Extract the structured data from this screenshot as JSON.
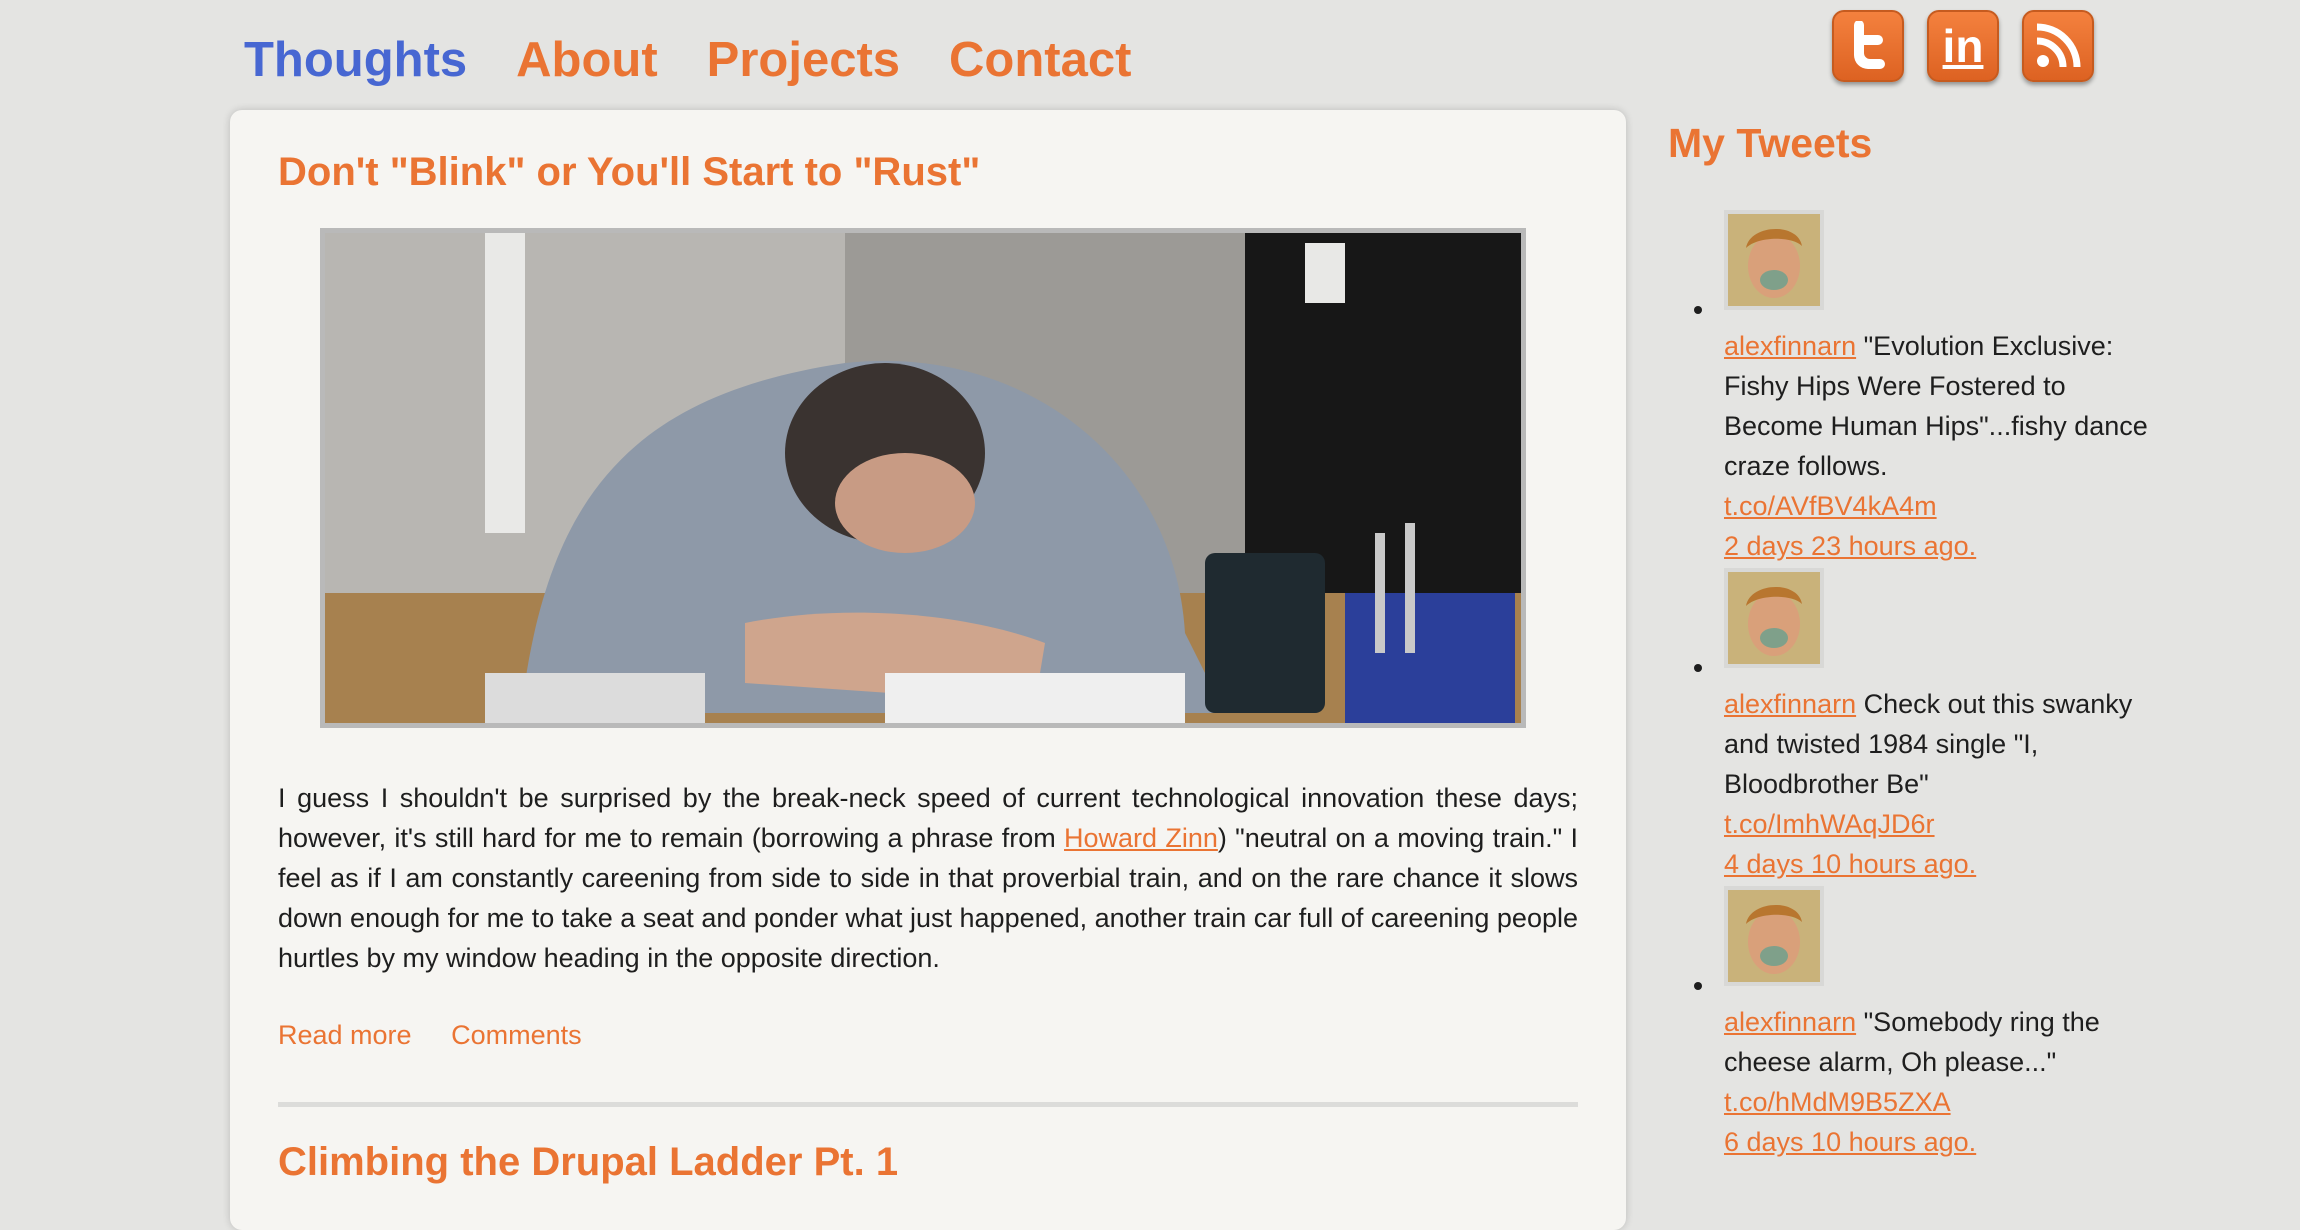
{
  "nav": {
    "items": [
      {
        "label": "Thoughts",
        "active": true
      },
      {
        "label": "About",
        "active": false
      },
      {
        "label": "Projects",
        "active": false
      },
      {
        "label": "Contact",
        "active": false
      }
    ]
  },
  "social": {
    "icons": [
      "twitter-icon",
      "linkedin-icon",
      "rss-icon"
    ],
    "linkedin_label": "in"
  },
  "post": {
    "title": "Don't \"Blink\" or You'll Start to \"Rust\"",
    "image_alt": "",
    "body_before_link": "I guess I shouldn't be surprised by the break-neck speed of current technological innovation these days; however, it's still hard for me to remain (borrowing a phrase from ",
    "body_link": "Howard Zinn",
    "body_after_link": ") \"neutral on a moving train.\" I feel as if I am constantly careening from side to side in that proverbial train, and on the rare chance it slows down enough for me to take a seat and ponder what just happened, another train car full of careening people hurtles by my window heading in the opposite direction.",
    "read_more": "Read more",
    "comments": "Comments"
  },
  "post2": {
    "title": "Climbing the Drupal Ladder Pt. 1"
  },
  "sidebar": {
    "title": "My Tweets",
    "tweets": [
      {
        "user": "alexfinnarn",
        "text": " \"Evolution Exclusive: Fishy Hips Were Fostered to Become Human Hips\"...fishy dance craze follows.",
        "link": "t.co/AVfBV4kA4m",
        "time": "2 days 23 hours ago."
      },
      {
        "user": "alexfinnarn",
        "text": " Check out this swanky and twisted 1984 single \"I, Bloodbrother Be\"",
        "link": "t.co/ImhWAqJD6r",
        "time": "4 days 10 hours ago."
      },
      {
        "user": "alexfinnarn",
        "text": " \"Somebody ring the cheese alarm, Oh please...\"",
        "link": "t.co/hMdM9B5ZXA",
        "time": "6 days 10 hours ago."
      }
    ]
  },
  "colors": {
    "accent": "#ea7433",
    "nav_active": "#4767d2",
    "background": "#e4e4e2",
    "card": "#f6f5f2"
  }
}
